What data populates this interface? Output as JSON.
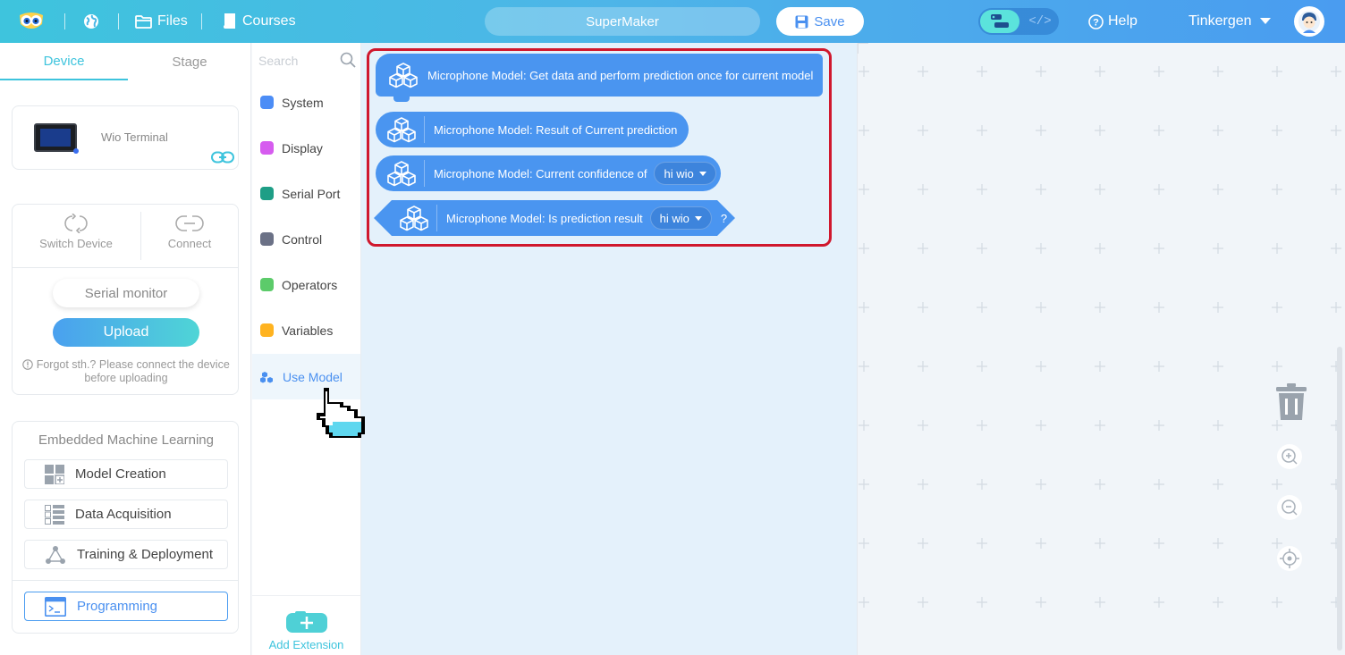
{
  "topbar": {
    "files_label": "Files",
    "courses_label": "Courses",
    "project_name": "SuperMaker",
    "save_label": "Save",
    "help_label": "Help",
    "user_name": "Tinkergen",
    "code_mode_glyph": "</>"
  },
  "left_panel": {
    "tabs": [
      "Device",
      "Stage"
    ],
    "device_name": "Wio Terminal",
    "switch_device_label": "Switch Device",
    "connect_label": "Connect",
    "serial_monitor_label": "Serial monitor",
    "upload_label": "Upload",
    "upload_hint": "Forgot sth.? Please connect the device before uploading",
    "ml_title": "Embedded Machine Learning",
    "ml_items": [
      "Model Creation",
      "Data Acquisition",
      "Training & Deployment"
    ],
    "programming_label": "Programming"
  },
  "categories": {
    "search_placeholder": "Search",
    "items": [
      {
        "label": "System",
        "color": "#4c8df6"
      },
      {
        "label": "Display",
        "color": "#d65cef"
      },
      {
        "label": "Serial Port",
        "color": "#1e9e86"
      },
      {
        "label": "Control",
        "color": "#6b7186"
      },
      {
        "label": "Operators",
        "color": "#5ccb6a"
      },
      {
        "label": "Variables",
        "color": "#ffb320"
      }
    ],
    "active_label": "Use Model",
    "add_extension_label": "Add Extension"
  },
  "blocks": {
    "b1_text": "Microphone Model: Get data and perform prediction once for current model",
    "b2_text": "Microphone Model: Result of Current prediction",
    "b3_text": "Microphone Model: Current confidence of",
    "b3_option": "hi wio",
    "b4_text": "Microphone Model: Is prediction result",
    "b4_option": "hi wio",
    "b4_suffix": "?"
  },
  "colors": {
    "accent": "#3ec4dd",
    "block_blue": "#4a95f0",
    "highlight_red": "#d0182d"
  }
}
